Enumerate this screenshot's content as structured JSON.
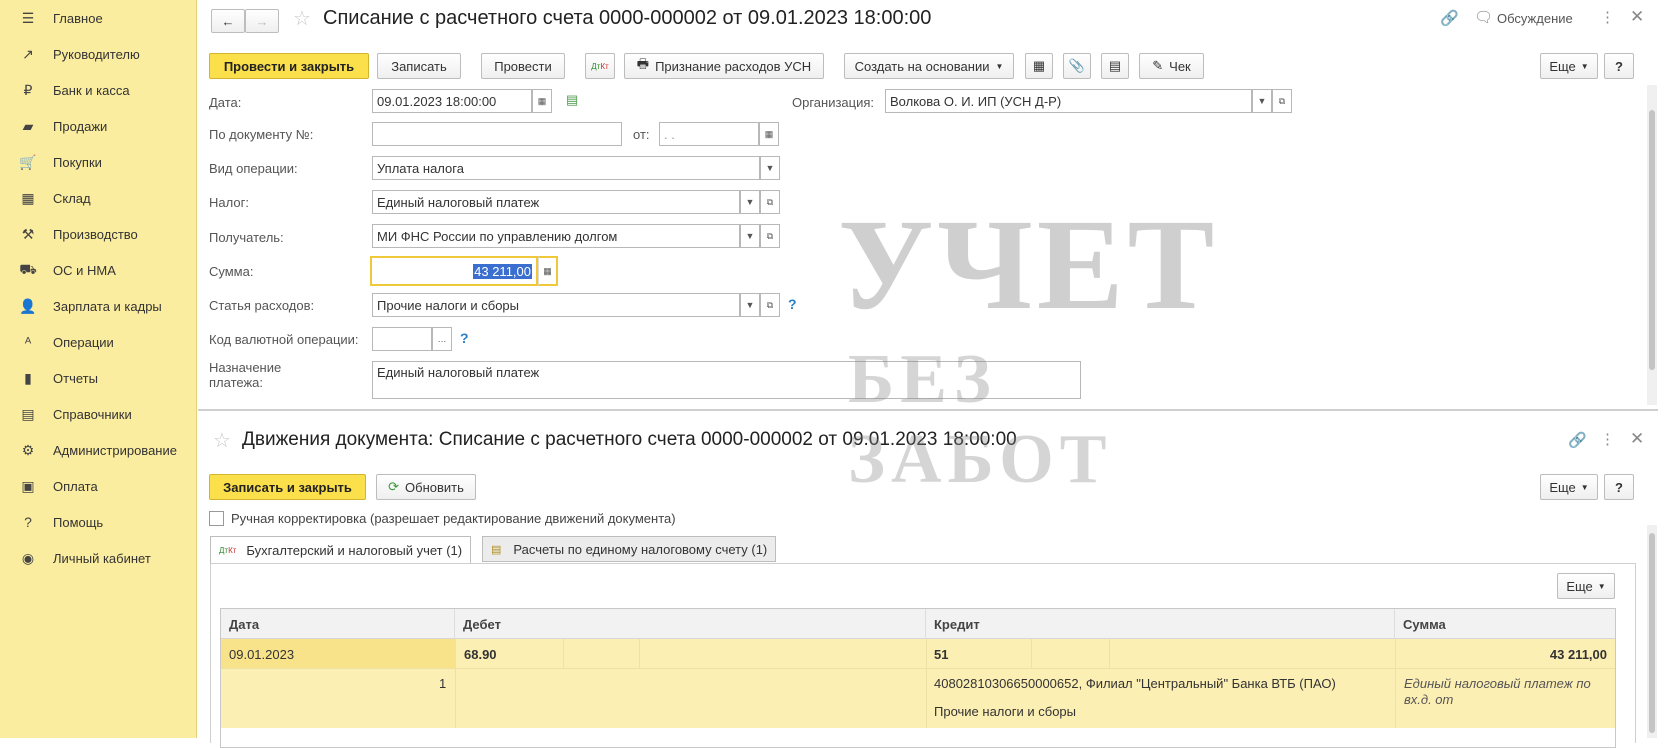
{
  "sidebar": {
    "items": [
      {
        "icon": "menu-icon",
        "glyph": "☰",
        "label": "Главное"
      },
      {
        "icon": "trend-icon",
        "glyph": "↗",
        "label": "Руководителю"
      },
      {
        "icon": "ruble-icon",
        "glyph": "₽",
        "label": "Банк и касса"
      },
      {
        "icon": "bag-icon",
        "glyph": "▰",
        "label": "Продажи"
      },
      {
        "icon": "cart-icon",
        "glyph": "🛒",
        "label": "Покупки"
      },
      {
        "icon": "warehouse-icon",
        "glyph": "▦",
        "label": "Склад"
      },
      {
        "icon": "factory-icon",
        "glyph": "⚒",
        "label": "Производство"
      },
      {
        "icon": "truck-icon",
        "glyph": "⛟",
        "label": "ОС и НМА"
      },
      {
        "icon": "person-icon",
        "glyph": "👤",
        "label": "Зарплата и кадры"
      },
      {
        "icon": "dt-kt-icon",
        "glyph": "ᴬ",
        "label": "Операции"
      },
      {
        "icon": "bar-chart-icon",
        "glyph": "▮",
        "label": "Отчеты"
      },
      {
        "icon": "book-icon",
        "glyph": "▤",
        "label": "Справочники"
      },
      {
        "icon": "gear-icon",
        "glyph": "⚙",
        "label": "Администрирование"
      },
      {
        "icon": "payment-icon",
        "glyph": "▣",
        "label": "Оплата"
      },
      {
        "icon": "help-icon",
        "glyph": "?",
        "label": "Помощь"
      },
      {
        "icon": "account-icon",
        "glyph": "◉",
        "label": "Личный кабинет"
      }
    ]
  },
  "doc": {
    "title": "Списание с расчетного счета 0000-000002 от 09.01.2023 18:00:00",
    "discussion": "Обсуждение",
    "toolbar": {
      "post_close": "Провести и закрыть",
      "save": "Записать",
      "post": "Провести",
      "usn": "Признание расходов УСН",
      "create_based": "Создать на основании",
      "check": "Чек",
      "more": "Еще",
      "help": "?"
    },
    "fields": {
      "date_label": "Дата:",
      "date_value": "09.01.2023 18:00:00",
      "org_label": "Организация:",
      "org_value": "Волкова О. И. ИП (УСН Д-Р)",
      "docnum_label": "По документу №:",
      "docnum_value": "",
      "from_label": "от:",
      "from_value": " .  . ",
      "optype_label": "Вид операции:",
      "optype_value": "Уплата налога",
      "tax_label": "Налог:",
      "tax_value": "Единый налоговый платеж",
      "recipient_label": "Получатель:",
      "recipient_value": "МИ ФНС России по управлению долгом",
      "sum_label": "Сумма:",
      "sum_value": "43 211,00",
      "expense_label": "Статья расходов:",
      "expense_value": "Прочие налоги и сборы",
      "currency_label": "Код валютной операции:",
      "currency_value": "",
      "purpose_label": "Назначение платежа:",
      "purpose_value": "Единый налоговый платеж"
    }
  },
  "movements": {
    "title": "Движения документа: Списание с расчетного счета 0000-000002 от 09.01.2023 18:00:00",
    "save_close": "Записать и закрыть",
    "refresh": "Обновить",
    "more": "Еще",
    "help": "?",
    "manual_label": "Ручная корректировка (разрешает редактирование движений документа)",
    "tabs": [
      "Бухгалтерский и налоговый учет (1)",
      "Расчеты по единому налоговому счету (1)"
    ],
    "table_more": "Еще",
    "columns": [
      "Дата",
      "Дебет",
      "Кредит",
      "Сумма"
    ],
    "row": {
      "date": "09.01.2023",
      "number": "1",
      "debit": "68.90",
      "credit": "51",
      "credit_detail1": "40802810306650000652, Филиал \"Центральный\" Банка ВТБ (ПАО)",
      "credit_detail2": "Прочие налоги и сборы",
      "sum": "43 211,00",
      "sum_note": "Единый налоговый платеж по вх.д.  от"
    }
  },
  "watermark": {
    "line1": "УЧЕТ",
    "line2": "БЕЗ ЗАБОТ"
  },
  "colors": {
    "sidebar_bg": "#fbeda0",
    "accent_button": "#fce04b",
    "row_highlight": "#fcefb4"
  }
}
